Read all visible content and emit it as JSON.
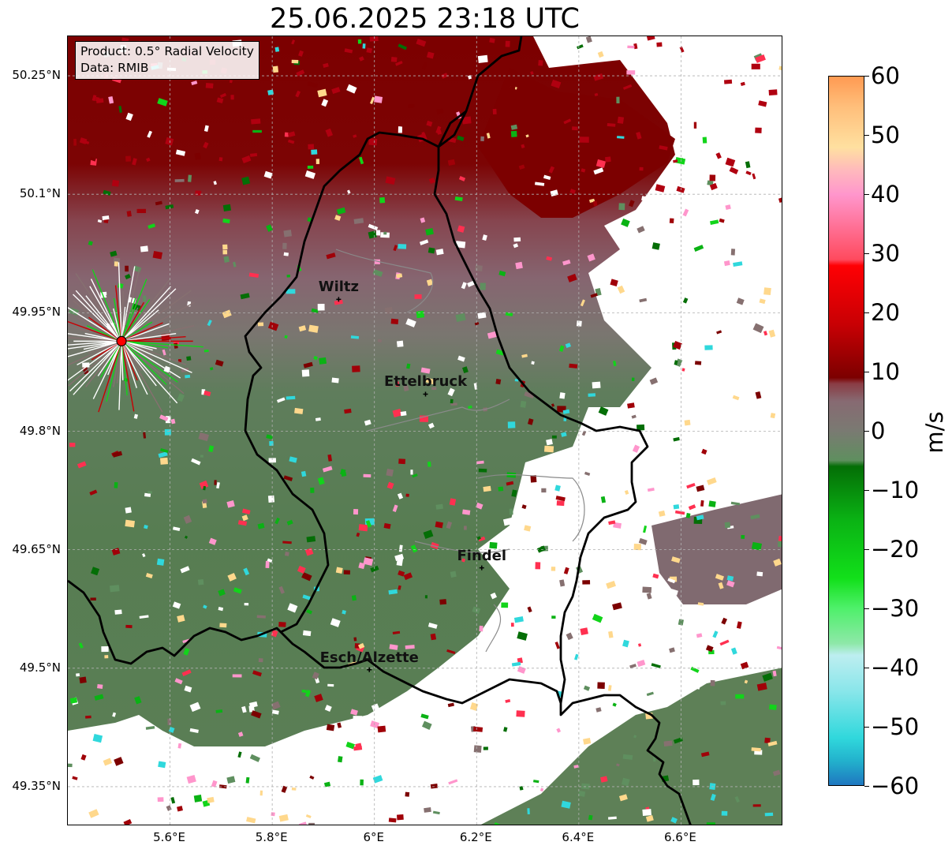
{
  "title": "25.06.2025 23:18 UTC",
  "info_box": {
    "product": "Product: 0.5° Radial Velocity",
    "data": "Data: RMIB"
  },
  "map": {
    "extent": {
      "lon": [
        5.4,
        6.8
      ],
      "lat": [
        49.3,
        50.3
      ]
    },
    "lat_ticks": [
      {
        "value": 50.25,
        "label": "50.25°N"
      },
      {
        "value": 50.1,
        "label": "50.1°N"
      },
      {
        "value": 49.95,
        "label": "49.95°N"
      },
      {
        "value": 49.8,
        "label": "49.8°N"
      },
      {
        "value": 49.65,
        "label": "49.65°N"
      },
      {
        "value": 49.5,
        "label": "49.5°N"
      },
      {
        "value": 49.35,
        "label": "49.35°N"
      }
    ],
    "lon_ticks": [
      {
        "value": 5.6,
        "label": "5.6°E"
      },
      {
        "value": 5.8,
        "label": "5.8°E"
      },
      {
        "value": 6.0,
        "label": "6°E"
      },
      {
        "value": 6.2,
        "label": "6.2°E"
      },
      {
        "value": 6.4,
        "label": "6.4°E"
      },
      {
        "value": 6.6,
        "label": "6.6°E"
      }
    ],
    "cities": [
      {
        "name": "Wiltz",
        "lon": 5.93,
        "lat": 49.967
      },
      {
        "name": "Ettelbruck",
        "lon": 6.1,
        "lat": 49.847
      },
      {
        "name": "Findel",
        "lon": 6.21,
        "lat": 49.627
      },
      {
        "name": "Esch/Alzette",
        "lon": 5.99,
        "lat": 49.498
      }
    ],
    "radar_site": {
      "lon": 5.505,
      "lat": 49.914,
      "color": "#ff0000"
    }
  },
  "colorbar": {
    "unit": "m/s",
    "min": -60,
    "max": 60,
    "ticks": [
      {
        "value": 60,
        "label": "60"
      },
      {
        "value": 50,
        "label": "50"
      },
      {
        "value": 40,
        "label": "40"
      },
      {
        "value": 30,
        "label": "30"
      },
      {
        "value": 20,
        "label": "20"
      },
      {
        "value": 10,
        "label": "10"
      },
      {
        "value": 0,
        "label": "0"
      },
      {
        "value": -10,
        "label": "−10"
      },
      {
        "value": -20,
        "label": "−20"
      },
      {
        "value": -30,
        "label": "−30"
      },
      {
        "value": -40,
        "label": "−40"
      },
      {
        "value": -50,
        "label": "−50"
      },
      {
        "value": -60,
        "label": "−60"
      }
    ],
    "stops": [
      {
        "value": -60,
        "color": "#1f77c0"
      },
      {
        "value": -56,
        "color": "#22b0cc"
      },
      {
        "value": -52,
        "color": "#30d8dc"
      },
      {
        "value": -44,
        "color": "#8ae6ea"
      },
      {
        "value": -38,
        "color": "#bdeef0"
      },
      {
        "value": -36,
        "color": "#8ee8a8"
      },
      {
        "value": -30,
        "color": "#4ef06a"
      },
      {
        "value": -25,
        "color": "#12e01a"
      },
      {
        "value": -15,
        "color": "#0ab214"
      },
      {
        "value": -6,
        "color": "#046e06"
      },
      {
        "value": -5,
        "color": "#5f8f5f"
      },
      {
        "value": 0,
        "color": "#7a7a72"
      },
      {
        "value": 5,
        "color": "#876a72"
      },
      {
        "value": 8,
        "color": "#8a3c44"
      },
      {
        "value": 9,
        "color": "#7c0000"
      },
      {
        "value": 18,
        "color": "#c80004"
      },
      {
        "value": 28,
        "color": "#ff0004"
      },
      {
        "value": 29,
        "color": "#ff4a5e"
      },
      {
        "value": 40,
        "color": "#ff96cc"
      },
      {
        "value": 44,
        "color": "#ffb8bd"
      },
      {
        "value": 48,
        "color": "#ffe0a0"
      },
      {
        "value": 55,
        "color": "#ffbe7a"
      },
      {
        "value": 60,
        "color": "#ff9a52"
      }
    ]
  },
  "colors": {
    "outbound_strong": "#7c0000",
    "outbound_weak": "#86656d",
    "neutral": "#737a6e",
    "inbound_weak": "#5a8055",
    "inbound_strong": "#046e06",
    "border": "#000000",
    "admin_border": "#888888"
  }
}
